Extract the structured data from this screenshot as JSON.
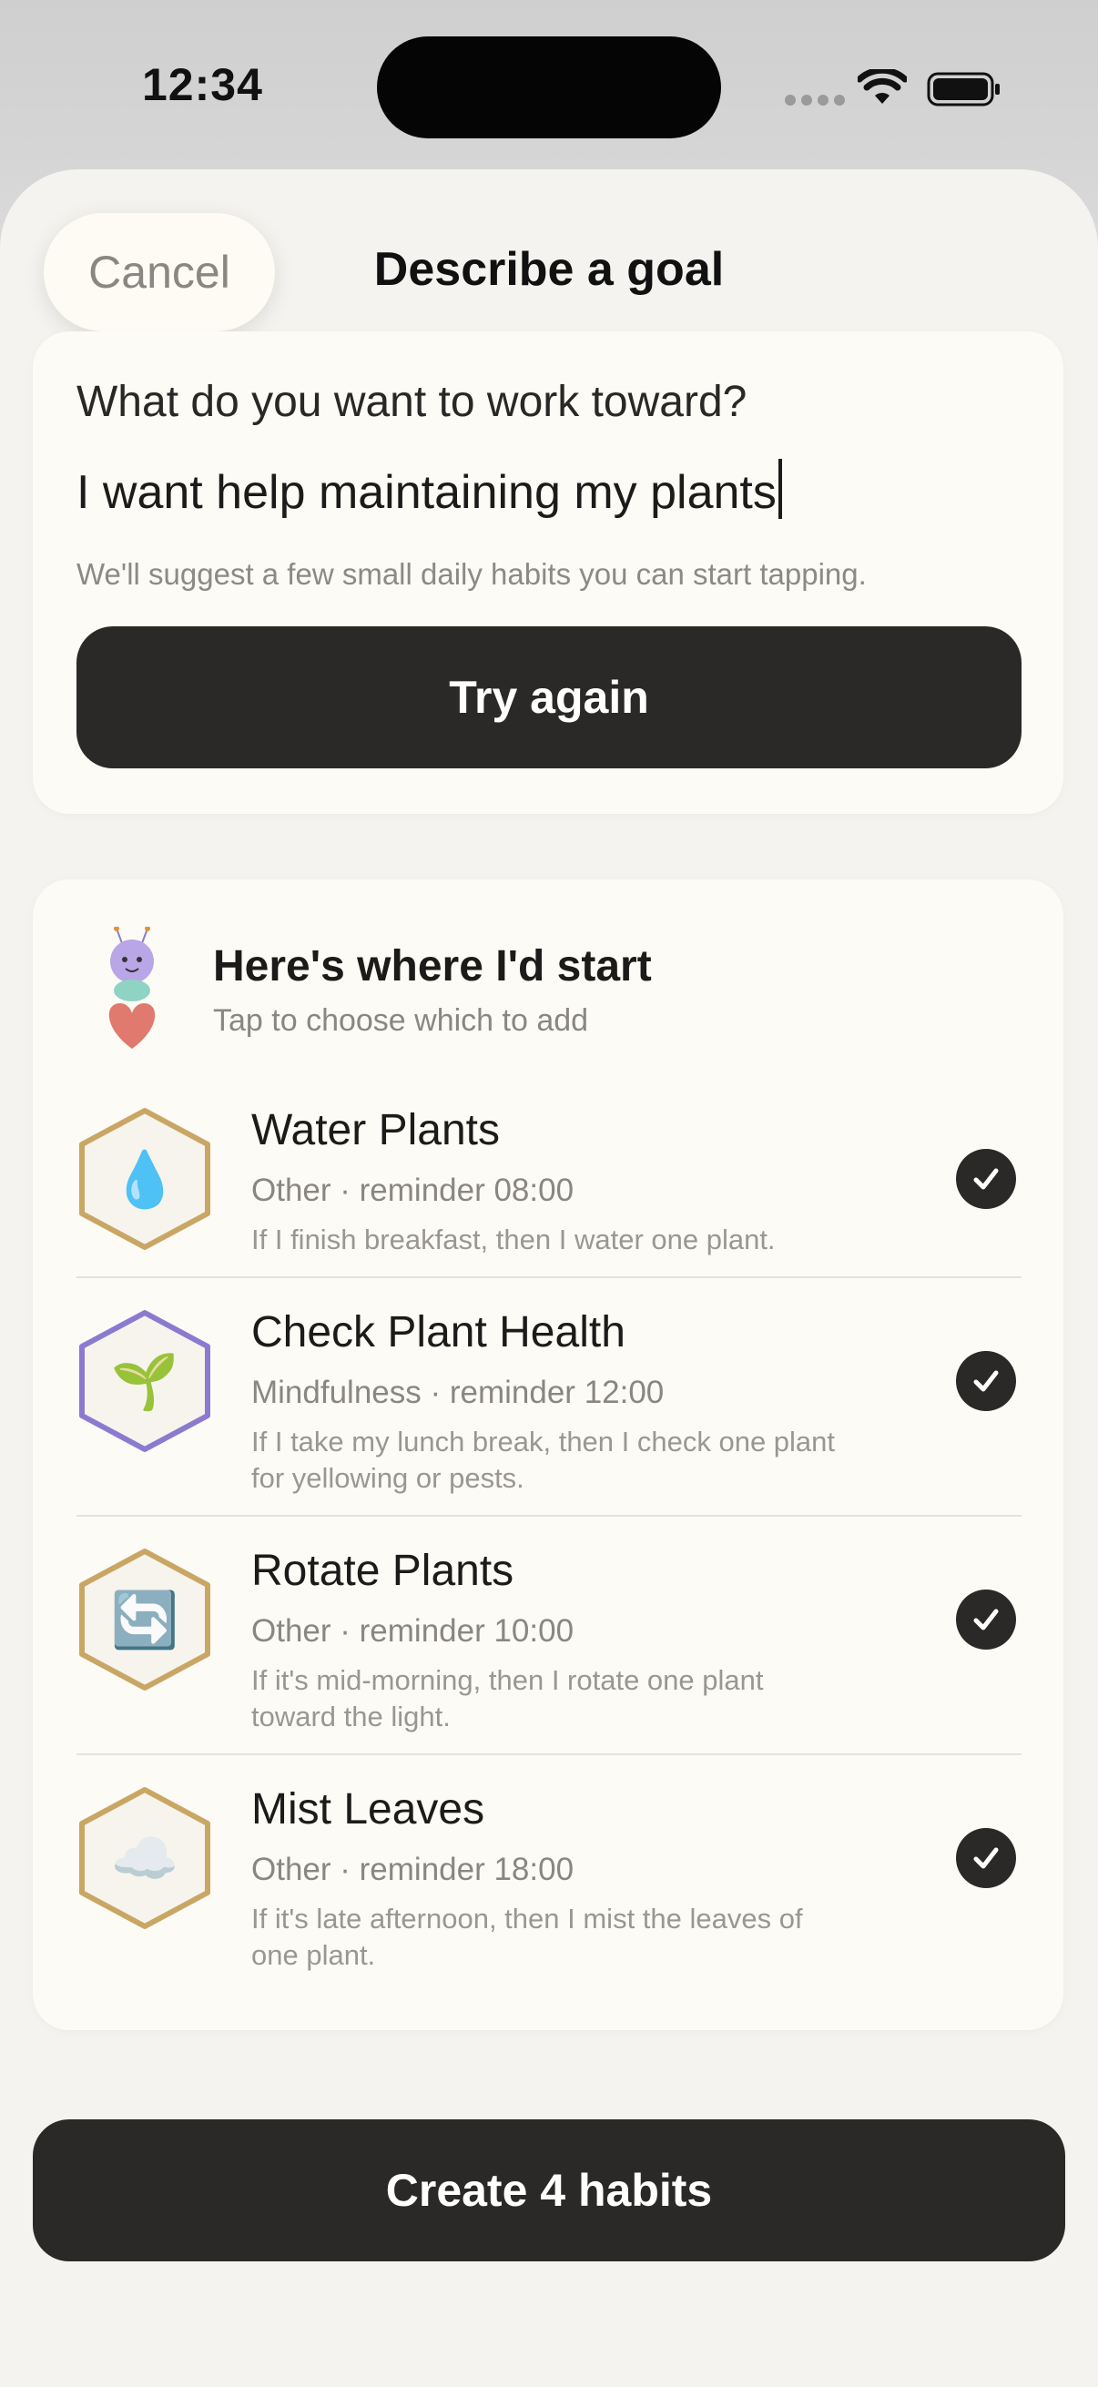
{
  "status_bar": {
    "time": "12:34"
  },
  "header": {
    "cancel_label": "Cancel",
    "title": "Describe a goal"
  },
  "goal": {
    "question": "What do you want to work toward?",
    "input_value": "I want help maintaining my plants",
    "hint": "We'll suggest a few small daily habits you can start tapping.",
    "try_again_label": "Try again"
  },
  "suggestions": {
    "title": "Here's where I'd start",
    "subtitle": "Tap to choose which to add",
    "habits": [
      {
        "name": "Water Plants",
        "meta": "Other · reminder 08:00",
        "description": "If I finish breakfast, then I water one plant.",
        "icon": "water-drop-icon",
        "emoji": "💧",
        "frame_color": "#c9a664",
        "selected": true
      },
      {
        "name": "Check Plant Health",
        "meta": "Mindfulness · reminder 12:00",
        "description": "If I take my lunch break, then I check one plant for yellowing or pests.",
        "icon": "seedling-icon",
        "emoji": "🌱",
        "frame_color": "#8a7bd0",
        "selected": true
      },
      {
        "name": "Rotate Plants",
        "meta": "Other · reminder 10:00",
        "description": "If it's mid-morning, then I rotate one plant toward the light.",
        "icon": "rotate-arrows-icon",
        "emoji": "🔄",
        "frame_color": "#c9a664",
        "selected": true
      },
      {
        "name": "Mist Leaves",
        "meta": "Other · reminder 18:00",
        "description": "If it's late afternoon, then I mist the leaves of one plant.",
        "icon": "cloud-icon",
        "emoji": "☁️",
        "frame_color": "#c9a664",
        "selected": true
      }
    ]
  },
  "create_label": "Create 4 habits",
  "colors": {
    "primary_button": "#2b2927",
    "sheet": "#f4f3ef",
    "card": "#fcfbf6"
  }
}
